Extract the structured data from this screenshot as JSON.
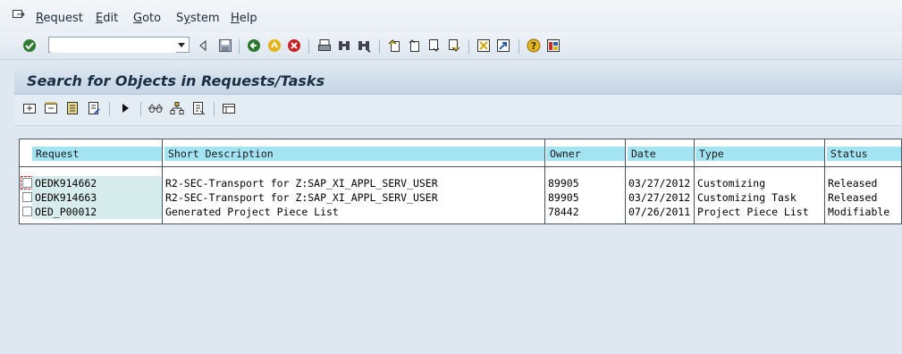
{
  "menubar": {
    "items": [
      {
        "label": "Request",
        "underline": "R"
      },
      {
        "label": "Edit",
        "underline": "E"
      },
      {
        "label": "Goto",
        "underline": "G"
      },
      {
        "label": "System",
        "underline": "y"
      },
      {
        "label": "Help",
        "underline": "H"
      }
    ]
  },
  "toolbar": {
    "command_field_value": "",
    "icons": [
      "enter-icon",
      "command-dropdown-icon",
      "back-arrow-icon",
      "save-icon",
      "back-icon",
      "exit-icon",
      "cancel-icon",
      "print-icon",
      "find-icon",
      "find-next-icon",
      "first-page-icon",
      "previous-page-icon",
      "next-page-icon",
      "last-page-icon",
      "create-session-icon",
      "shortcut-icon",
      "help-icon",
      "customize-layout-icon"
    ]
  },
  "screen": {
    "title": "Search for Objects in Requests/Tasks"
  },
  "app_toolbar": {
    "icons": [
      "expand-icon",
      "collapse-icon",
      "display-icon",
      "change-icon",
      "execute-icon",
      "glasses-icon",
      "hierarchy-icon",
      "document-icon",
      "layout-icon"
    ]
  },
  "table": {
    "columns": [
      "Request",
      "Short Description",
      "Owner",
      "Date",
      "Type",
      "Status"
    ],
    "rows": [
      {
        "request": "OEDK914662",
        "description": "R2-SEC-Transport for Z:SAP_XI_APPL_SERV_USER",
        "owner": "89905",
        "date": "03/27/2012",
        "type": "Customizing",
        "status": "Released",
        "checked": false,
        "focused": true
      },
      {
        "request": "OEDK914663",
        "description": "R2-SEC-Transport for Z:SAP_XI_APPL_SERV_USER",
        "owner": "89905",
        "date": "03/27/2012",
        "type": "Customizing Task",
        "status": "Released",
        "checked": false,
        "focused": false
      },
      {
        "request": "OED_P00012",
        "description": "Generated Project Piece List",
        "owner": "78442",
        "date": "07/26/2011",
        "type": "Project Piece List",
        "status": "Modifiable",
        "checked": false,
        "focused": false
      }
    ]
  },
  "colors": {
    "header_bg": "#a3e3f2",
    "key_cell_bg": "#d7ecec",
    "title_color": "#1a2e44"
  }
}
